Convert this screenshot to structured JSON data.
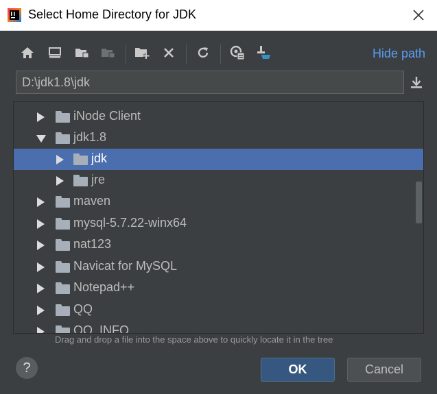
{
  "window": {
    "title": "Select Home Directory for JDK",
    "app_icon": "intellij-idea-icon",
    "close_icon": "close-icon"
  },
  "toolbar": {
    "icons": [
      "home-icon",
      "desktop-icon",
      "project-folder-icon",
      "module-folder-icon",
      "new-folder-icon",
      "delete-icon",
      "refresh-icon",
      "show-hidden-icon",
      "pin-icon"
    ],
    "hide_path_label": "Hide path"
  },
  "path": {
    "value": "D:\\jdk1.8\\jdk"
  },
  "tree": {
    "items": [
      {
        "label": "iNode Client",
        "state": "collapsed",
        "level": 0
      },
      {
        "label": "jdk1.8",
        "state": "expanded",
        "level": 0
      },
      {
        "label": "jdk",
        "state": "collapsed",
        "level": 1,
        "selected": true
      },
      {
        "label": "jre",
        "state": "collapsed",
        "level": 1
      },
      {
        "label": "maven",
        "state": "collapsed",
        "level": 0
      },
      {
        "label": "mysql-5.7.22-winx64",
        "state": "collapsed",
        "level": 0
      },
      {
        "label": "nat123",
        "state": "collapsed",
        "level": 0
      },
      {
        "label": "Navicat for MySQL",
        "state": "collapsed",
        "level": 0
      },
      {
        "label": "Notepad++",
        "state": "collapsed",
        "level": 0
      },
      {
        "label": "QQ",
        "state": "collapsed",
        "level": 0
      },
      {
        "label": "QQ_INFO",
        "state": "collapsed",
        "level": 0
      }
    ]
  },
  "hint": "Drag and drop a file into the space above to quickly locate it in the tree",
  "buttons": {
    "help": "?",
    "ok": "OK",
    "cancel": "Cancel"
  },
  "colors": {
    "background": "#3c3f41",
    "selection": "#4b6eaf",
    "link": "#589df6",
    "ok_button": "#365880"
  }
}
